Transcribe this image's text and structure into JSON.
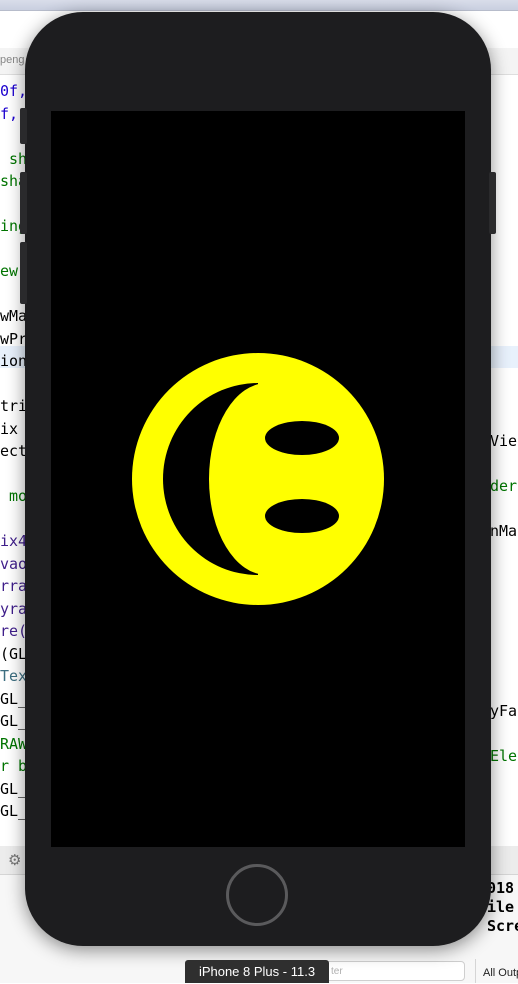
{
  "editor": {
    "tab_path": "peng",
    "code_left": [
      {
        "text": "0f,",
        "kind": "num"
      },
      {
        "text": "f,",
        "kind": "num"
      },
      {
        "text": "",
        "kind": "plain"
      },
      {
        "text": " sh",
        "kind": "com"
      },
      {
        "text": "sha",
        "kind": "com"
      },
      {
        "text": "",
        "kind": "plain"
      },
      {
        "text": "ing",
        "kind": "com"
      },
      {
        "text": "",
        "kind": "plain"
      },
      {
        "text": "ew ",
        "kind": "com"
      },
      {
        "text": "",
        "kind": "plain"
      },
      {
        "text": "wMa",
        "kind": "plain"
      },
      {
        "text": "wPr",
        "kind": "plain"
      },
      {
        "text": "ion",
        "kind": "plain"
      },
      {
        "text": "",
        "kind": "plain"
      },
      {
        "text": "tri",
        "kind": "plain"
      },
      {
        "text": "ix ",
        "kind": "plain"
      },
      {
        "text": "ect",
        "kind": "plain"
      },
      {
        "text": "",
        "kind": "plain"
      },
      {
        "text": " mo",
        "kind": "com"
      },
      {
        "text": "",
        "kind": "plain"
      },
      {
        "text": "ix4",
        "kind": "typ"
      },
      {
        "text": "vao",
        "kind": "typ"
      },
      {
        "text": "rra",
        "kind": "typ"
      },
      {
        "text": "yra",
        "kind": "typ"
      },
      {
        "text": "re(",
        "kind": "typ"
      },
      {
        "text": "(GL",
        "kind": "plain"
      },
      {
        "text": "Tex",
        "kind": "fn"
      },
      {
        "text": "GL_",
        "kind": "plain"
      },
      {
        "text": "GL_",
        "kind": "plain"
      },
      {
        "text": "RAW",
        "kind": "com"
      },
      {
        "text": "r b",
        "kind": "com"
      },
      {
        "text": "GL_",
        "kind": "plain"
      },
      {
        "text": "GL_",
        "kind": "plain"
      }
    ],
    "code_right": [
      {
        "text": "Vie",
        "kind": "plain"
      },
      {
        "text": "",
        "kind": "plain"
      },
      {
        "text": "der",
        "kind": "com"
      },
      {
        "text": "",
        "kind": "plain"
      },
      {
        "text": "nMa",
        "kind": "plain"
      },
      {
        "text": "",
        "kind": "plain"
      },
      {
        "text": "",
        "kind": "plain"
      },
      {
        "text": "",
        "kind": "plain"
      },
      {
        "text": "",
        "kind": "plain"
      },
      {
        "text": "",
        "kind": "plain"
      },
      {
        "text": "",
        "kind": "plain"
      },
      {
        "text": "",
        "kind": "plain"
      },
      {
        "text": "yFa",
        "kind": "plain"
      },
      {
        "text": "",
        "kind": "plain"
      },
      {
        "text": "Ele",
        "kind": "com"
      }
    ],
    "console_text": "018\nile\nScre",
    "filter_placeholder": "ter",
    "output_selector": "All Output"
  },
  "simulator": {
    "device_label": "iPhone 8 Plus - 11.3",
    "colors": {
      "bezel": "#1d1d1f",
      "screen_background": "#000000",
      "smiley_face": "#ffff00",
      "smiley_features": "#000000"
    },
    "smiley_icon": "smiley-face-rotated-icon"
  }
}
